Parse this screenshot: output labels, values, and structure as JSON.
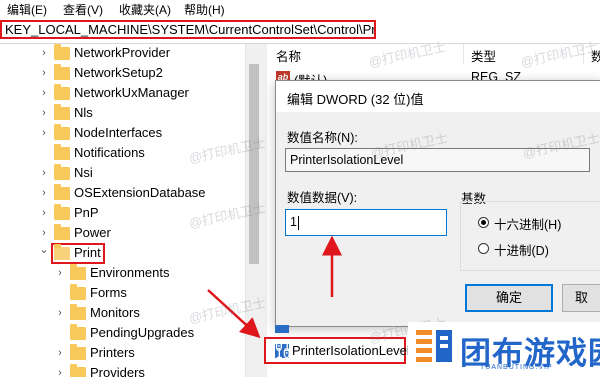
{
  "menu": [
    {
      "label": "编辑(E)"
    },
    {
      "label": "查看(V)"
    },
    {
      "label": "收藏夹(A)"
    },
    {
      "label": "帮助(H)"
    }
  ],
  "address_path": "KEY_LOCAL_MACHINE\\SYSTEM\\CurrentControlSet\\Control\\Print",
  "tree": {
    "items": [
      {
        "label": "NetworkProvider"
      },
      {
        "label": "NetworkSetup2"
      },
      {
        "label": "NetworkUxManager"
      },
      {
        "label": "Nls"
      },
      {
        "label": "NodeInterfaces"
      },
      {
        "label": "Notifications"
      },
      {
        "label": "Nsi"
      },
      {
        "label": "OSExtensionDatabase"
      },
      {
        "label": "PnP"
      },
      {
        "label": "Power"
      },
      {
        "label": "Print",
        "selected": true
      },
      {
        "label": "Environments"
      },
      {
        "label": "Forms"
      },
      {
        "label": "Monitors"
      },
      {
        "label": "PendingUpgrades"
      },
      {
        "label": "Printers"
      },
      {
        "label": "Providers"
      }
    ],
    "chevron_right": "›",
    "chevron_down": "⌄"
  },
  "list": {
    "col_name": "名称",
    "col_type": "类型",
    "col_data": "数",
    "default_row": {
      "name": "(默认)",
      "type": "REG_SZ"
    },
    "highlighted_value": "PrinterIsolationLevel"
  },
  "dialog": {
    "title": "编辑 DWORD (32 位)值",
    "value_name_label": "数值名称(N):",
    "value_name": "PrinterIsolationLevel",
    "value_data_label": "数值数据(V):",
    "value_data": "1",
    "base_label": "基数",
    "base_hex": "十六进制(H)",
    "base_dec": "十进制(D)",
    "ok": "确定",
    "cancel": "取"
  },
  "watermark": "@打印机卫士",
  "logo": {
    "text": "团布游戏园",
    "sub": "TUANBUTING.VIP"
  },
  "colors": {
    "highlight_red": "#e0161d",
    "accent_blue": "#0078d7",
    "logo_blue": "#2266c9",
    "folder": "#f6c95a"
  }
}
